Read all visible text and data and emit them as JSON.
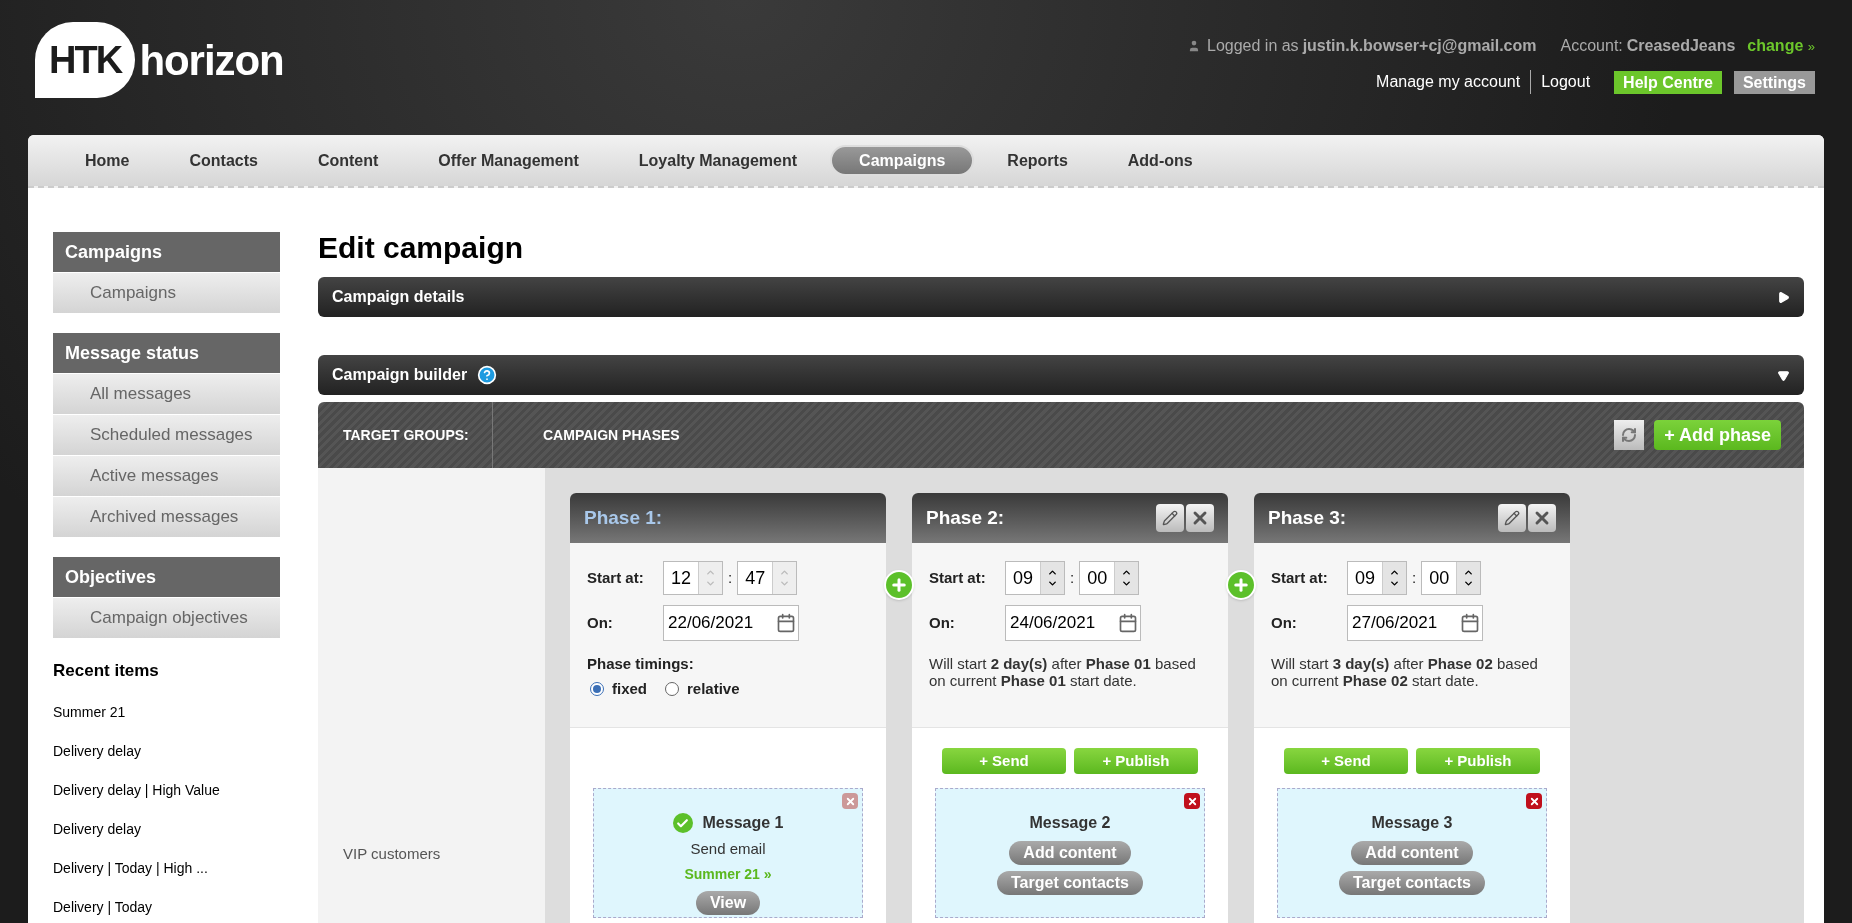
{
  "header": {
    "logo_badge": "HTK",
    "logo_word": "horizon",
    "logged_in_label": "Logged in as",
    "user_email": "justin.k.bowser+cj@gmail.com",
    "account_label": "Account:",
    "account_name": "CreasedJeans",
    "change_link": "change",
    "change_arrow": "»",
    "links": [
      {
        "label": "Manage my account",
        "kind": "link"
      },
      {
        "label": "Logout",
        "kind": "link"
      },
      {
        "label": "Help Centre",
        "kind": "green"
      },
      {
        "label": "Settings",
        "kind": "gray"
      }
    ]
  },
  "nav": [
    {
      "label": "Home",
      "selected": false
    },
    {
      "label": "Contacts",
      "selected": false
    },
    {
      "label": "Content",
      "selected": false
    },
    {
      "label": "Offer Management",
      "selected": false
    },
    {
      "label": "Loyalty Management",
      "selected": false
    },
    {
      "label": "Campaigns",
      "selected": true
    },
    {
      "label": "Reports",
      "selected": false
    },
    {
      "label": "Add-ons",
      "selected": false
    }
  ],
  "sidebar": {
    "sections": [
      {
        "title": "Campaigns",
        "items": [
          "Campaigns"
        ]
      },
      {
        "title": "Message status",
        "items": [
          "All messages",
          "Scheduled messages",
          "Active messages",
          "Archived messages"
        ]
      },
      {
        "title": "Objectives",
        "items": [
          "Campaign objectives"
        ]
      }
    ],
    "recent_title": "Recent items",
    "recent_items": [
      "Summer 21",
      "Delivery delay",
      "Delivery delay | High Value",
      "Delivery delay",
      "Delivery | Today | High ...",
      "Delivery | Today"
    ]
  },
  "page_title": "Edit campaign",
  "panels": [
    {
      "title": "Campaign details",
      "expanded": false,
      "help": false
    },
    {
      "title": "Campaign builder",
      "expanded": true,
      "help": true
    }
  ],
  "builder": {
    "target_groups_label": "TARGET GROUPS:",
    "phases_label": "CAMPAIGN PHASES",
    "add_phase": "+ Add phase",
    "target_groups": [
      "VIP customers"
    ],
    "phases": [
      {
        "title": "Phase 1:",
        "locked": true,
        "start_label": "Start at:",
        "hour": "12",
        "minute": "47",
        "separator": ":",
        "on_label": "On:",
        "date": "22/06/2021",
        "timings": {
          "label": "Phase timings:",
          "options": [
            {
              "label": "fixed",
              "selected": true
            },
            {
              "label": "relative",
              "selected": false
            }
          ]
        },
        "message": {
          "title": "Message 1",
          "sent": true,
          "lines": [
            {
              "kind": "text",
              "text": "Send email"
            },
            {
              "kind": "link",
              "text": "Summer 21",
              "arrow": "»"
            },
            {
              "kind": "button",
              "text": "View"
            }
          ]
        }
      },
      {
        "title": "Phase 2:",
        "locked": false,
        "start_label": "Start at:",
        "hour": "09",
        "minute": "00",
        "separator": ":",
        "on_label": "On:",
        "date": "24/06/2021",
        "note": "Will start **2 day(s)** after **Phase 01** based on current **Phase 01** start date.",
        "actions": [
          "+ Send",
          "+ Publish"
        ],
        "message": {
          "title": "Message 2",
          "sent": false,
          "lines": [
            {
              "kind": "button",
              "text": "Add content"
            },
            {
              "kind": "button",
              "text": "Target contacts"
            }
          ]
        }
      },
      {
        "title": "Phase 3:",
        "locked": false,
        "start_label": "Start at:",
        "hour": "09",
        "minute": "00",
        "separator": ":",
        "on_label": "On:",
        "date": "27/06/2021",
        "note": "Will start **3 day(s)** after **Phase 02** based on current **Phase 02** start date.",
        "actions": [
          "+ Send",
          "+ Publish"
        ],
        "message": {
          "title": "Message 3",
          "sent": false,
          "lines": [
            {
              "kind": "button",
              "text": "Add content"
            },
            {
              "kind": "button",
              "text": "Target contacts"
            }
          ]
        }
      }
    ]
  }
}
